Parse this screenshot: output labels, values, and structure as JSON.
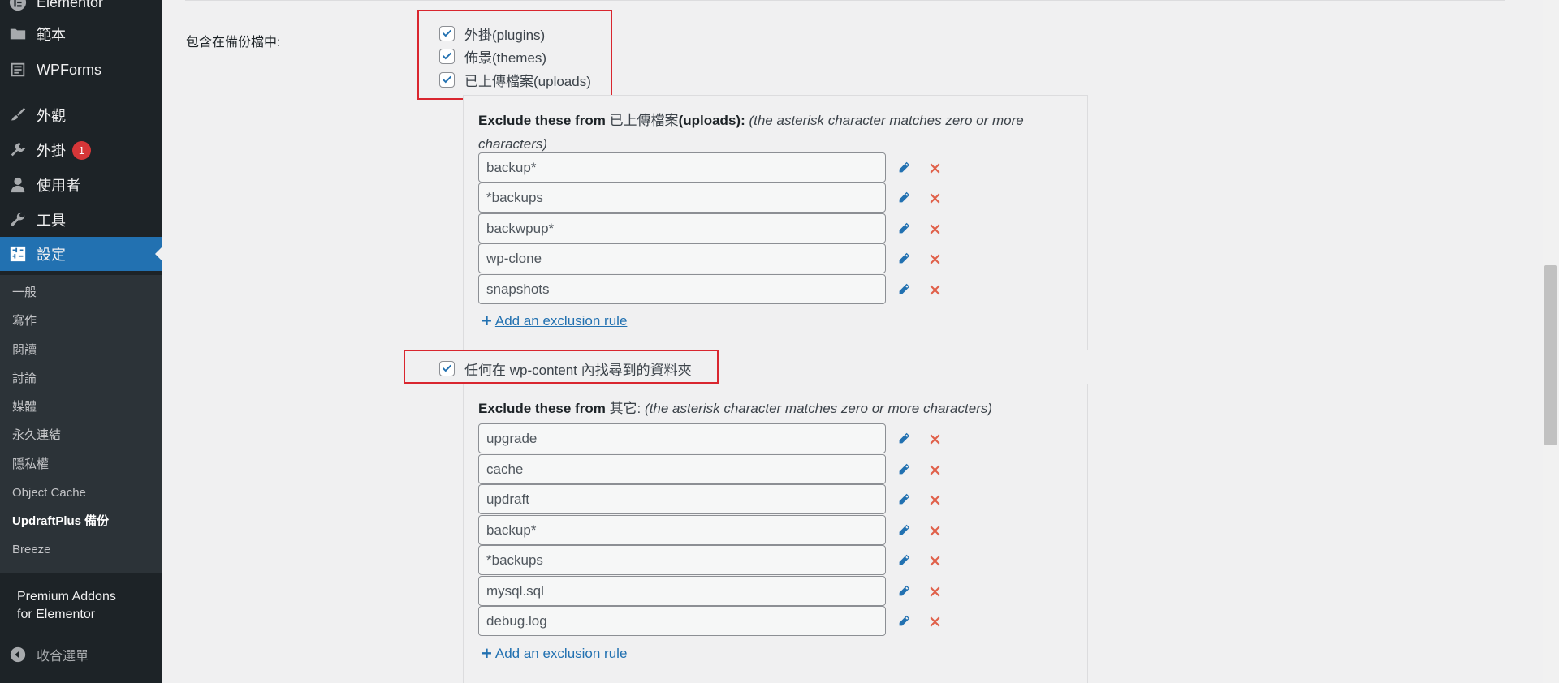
{
  "sidebar": {
    "menu": [
      {
        "label": "Elementor",
        "icon": "elementor-icon"
      },
      {
        "label": "範本",
        "icon": "folder-icon"
      },
      {
        "label": "WPForms",
        "icon": "form-icon"
      },
      {
        "label": "外觀",
        "icon": "paintbrush-icon"
      },
      {
        "label": "外掛",
        "icon": "plugin-icon",
        "badge": "1"
      },
      {
        "label": "使用者",
        "icon": "user-icon"
      },
      {
        "label": "工具",
        "icon": "wrench-icon"
      },
      {
        "label": "設定",
        "icon": "settings-icon",
        "active": true
      }
    ],
    "submenu": [
      {
        "label": "一般"
      },
      {
        "label": "寫作"
      },
      {
        "label": "閱讀"
      },
      {
        "label": "討論"
      },
      {
        "label": "媒體"
      },
      {
        "label": "永久連結"
      },
      {
        "label": "隱私權"
      },
      {
        "label": "Object Cache"
      },
      {
        "label": "UpdraftPlus 備份",
        "current": true
      },
      {
        "label": "Breeze"
      }
    ],
    "premium": {
      "label_line1": "Premium Addons",
      "label_line2": "for Elementor",
      "icon": "star-icon"
    },
    "collapse": {
      "label": "收合選單",
      "icon": "collapse-arrow-icon"
    }
  },
  "main": {
    "row_label": "包含在備份檔中:",
    "include_options": [
      {
        "label": "外掛(plugins)",
        "checked": true
      },
      {
        "label": "佈景(themes)",
        "checked": true
      },
      {
        "label": "已上傳檔案(uploads)",
        "checked": true
      }
    ],
    "uploads_panel": {
      "head_bold": "Exclude these from",
      "head_target": "已上傳檔案",
      "head_target_bold": "(uploads)",
      "head_colon": ":",
      "head_note": "(the asterisk character matches zero or more characters)",
      "rules": [
        "backup*",
        "*backups",
        "backwpup*",
        "wp-clone",
        "snapshots"
      ],
      "add_label": "Add an exclusion rule"
    },
    "other_option": {
      "label": "任何在 wp-content 內找尋到的資料夾",
      "checked": true
    },
    "other_panel": {
      "head_bold": "Exclude these from",
      "head_target": "其它:",
      "head_note": "(the asterisk character matches zero or more characters)",
      "rules": [
        "upgrade",
        "cache",
        "updraft",
        "backup*",
        "*backups",
        "mysql.sql",
        "debug.log"
      ],
      "add_label": "Add an exclusion rule"
    }
  },
  "colors": {
    "accent": "#2271b1",
    "highlight_box": "#d9262f",
    "delete": "#e0604a",
    "sidebar": "#1d2327"
  }
}
